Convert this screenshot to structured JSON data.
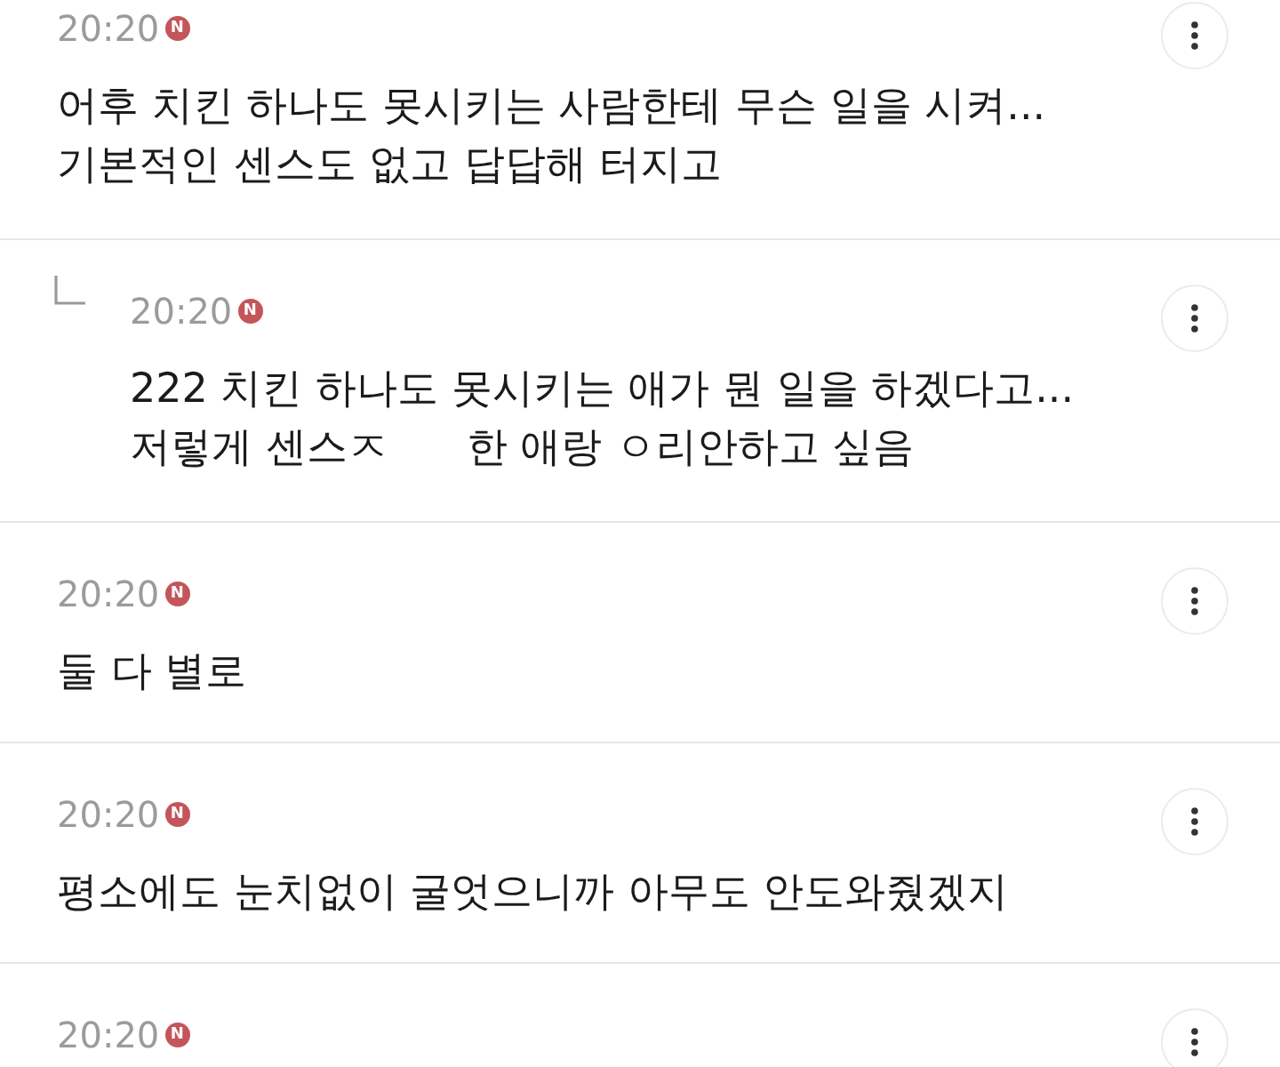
{
  "comments": [
    {
      "kind": "comment",
      "time": "20:20",
      "badge": "N",
      "lines": [
        [
          "어후 치킨 하나도 못시키는 사람한테 무슨 일을 시켜..."
        ],
        [
          "기본적인 센스도 없고 답답해 터지고"
        ]
      ]
    },
    {
      "kind": "reply",
      "time": "20:20",
      "badge": "N",
      "lines": [
        [
          "222 치킨 하나도 못시키는 애가 뭔 일을 하겠다고..."
        ],
        [
          "저렇게 센스ㅈ",
          "한 애랑 ㅇ리안하고 싶음"
        ]
      ]
    },
    {
      "kind": "comment",
      "time": "20:20",
      "badge": "N",
      "lines": [
        [
          "둘 다 별로"
        ]
      ]
    },
    {
      "kind": "comment",
      "time": "20:20",
      "badge": "N",
      "lines": [
        [
          "평소에도 눈치없이 굴엇으니까 아무도 안도와줬겠지"
        ]
      ]
    },
    {
      "kind": "comment",
      "time": "20:20",
      "badge": "N"
    }
  ]
}
